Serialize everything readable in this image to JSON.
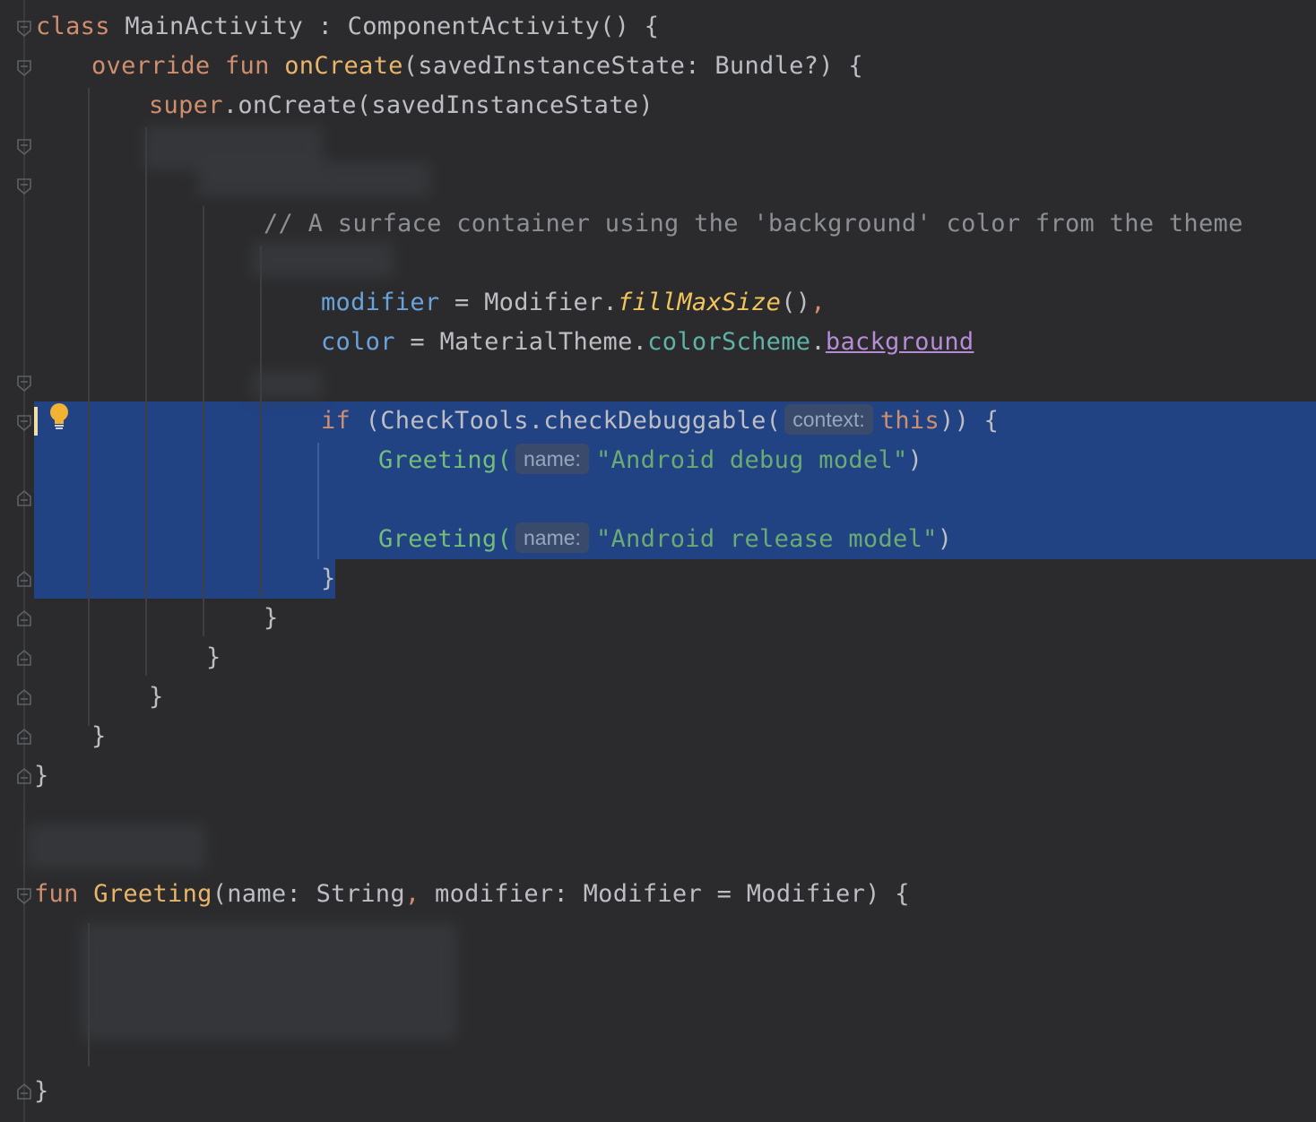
{
  "editor": {
    "lines": [
      {
        "id": "class-decl",
        "text": "class MainActivity : ComponentActivity() {"
      },
      {
        "id": "on-create",
        "text": "override fun onCreate(savedInstanceState: Bundle?) {"
      },
      {
        "id": "super-call",
        "text": "super.onCreate(savedInstanceState)"
      },
      {
        "id": "comment",
        "text": "// A surface container using the 'background' color from the theme"
      },
      {
        "id": "modifier-arg",
        "text": "modifier = Modifier.fillMaxSize(),"
      },
      {
        "id": "color-arg",
        "text": "color = MaterialTheme.colorScheme.background"
      },
      {
        "id": "if-line",
        "text": "if (CheckTools.checkDebuggable( context: this)) {"
      },
      {
        "id": "greet-debug",
        "text": "Greeting( name: \"Android debug model\")"
      },
      {
        "id": "greet-release",
        "text": "Greeting( name: \"Android release model\")"
      },
      {
        "id": "close-if",
        "text": "}"
      },
      {
        "id": "close-1",
        "text": "}"
      },
      {
        "id": "close-2",
        "text": "}"
      },
      {
        "id": "close-3",
        "text": "}"
      },
      {
        "id": "close-4",
        "text": "}"
      },
      {
        "id": "close-class",
        "text": "}"
      },
      {
        "id": "fun-greeting",
        "text": "fun Greeting(name: String, modifier: Modifier = Modifier) {"
      },
      {
        "id": "close-fun",
        "text": "}"
      }
    ],
    "tokens": {
      "class_kw": "class",
      "class_name": "MainActivity : ComponentActivity() {",
      "override_kw": "override fun",
      "on_create": "onCreate",
      "on_create_args": "(savedInstanceState: Bundle?) {",
      "super_kw": "super",
      "super_rest": ".onCreate(savedInstanceState)",
      "comment": "// A surface container using the 'background' color from the theme",
      "modifier_name": "modifier",
      "modifier_eq": " = Modifier.",
      "fill_max": "fillMaxSize",
      "modifier_tail": "()",
      "comma": ",",
      "color_name": "color",
      "color_eq": " = MaterialTheme.",
      "color_scheme": "colorScheme",
      "dot": ".",
      "background": "background",
      "if_kw": "if",
      "if_call": " (CheckTools.checkDebuggable(",
      "context_hint": "context:",
      "this_kw": "this",
      "if_tail": ")) {",
      "greeting": "Greeting(",
      "name_hint": "name:",
      "debug_str": "\"Android debug model\"",
      "release_str": "\"Android release model\"",
      "close_paren": ")",
      "brace": "}",
      "fun_kw": "fun",
      "greeting_fn": "Greeting",
      "greeting_sig": "(name: String",
      "greeting_sig2": " modifier: Modifier = Modifier) {"
    },
    "colors": {
      "background": "#2b2b2d",
      "selection": "#214283",
      "keyword": "#cf8e6d",
      "string": "#6aab73",
      "comment": "#8c8f94"
    },
    "icons": [
      "lightbulb-icon",
      "fold-icon"
    ]
  }
}
